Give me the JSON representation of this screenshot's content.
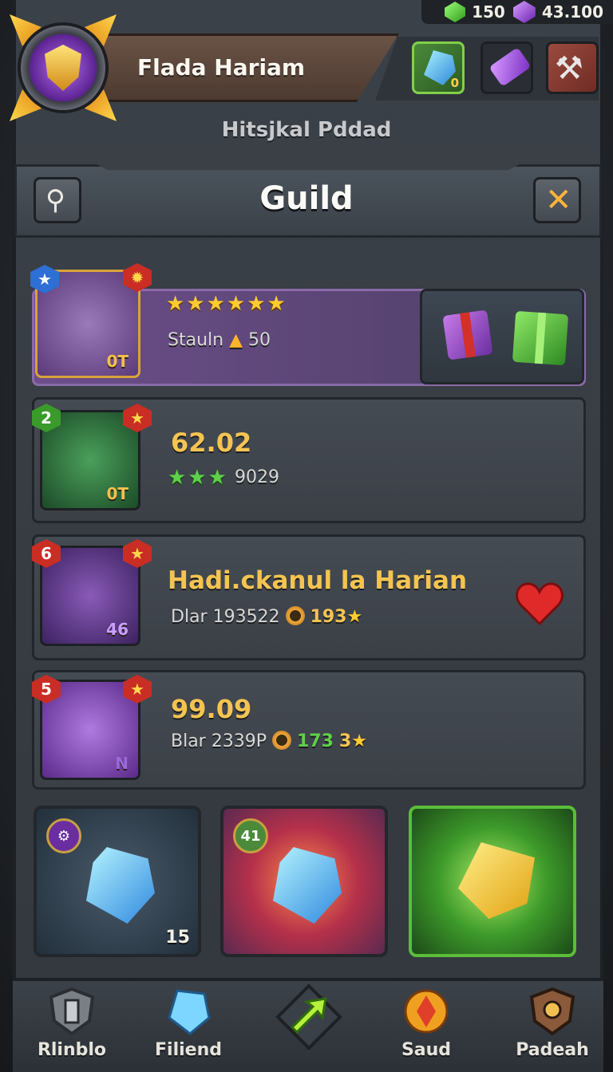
{
  "currency": {
    "green_gems": "150",
    "purple_gems": "43.100"
  },
  "header": {
    "title": "Flada Hariam",
    "subtitle": "Ηitsjkal Pddad",
    "crystal_badge": "0"
  },
  "guild_bar": {
    "title": "Guild"
  },
  "rows": [
    {
      "stars": "★★★★★★",
      "subtitle": "Stauln",
      "subtitle_value": "50",
      "thumb_label": "0T"
    },
    {
      "badge": "2",
      "title": "62.02",
      "stars": "★★★",
      "subtitle": "9029",
      "thumb_label": "0T"
    },
    {
      "badge": "6",
      "title": "Hadi.ckanul la Harian",
      "subtitle": "Dlar 193522",
      "subtitle_value": "193",
      "thumb_label": "46"
    },
    {
      "badge": "5",
      "title": "99.09",
      "subtitle": "Blar 2339P",
      "subtitle_value": "3",
      "subtitle_extra": "173",
      "thumb_label": "N"
    }
  ],
  "tiles": [
    {
      "count": "15"
    },
    {
      "badge": "41"
    },
    {}
  ],
  "bottom_nav": [
    {
      "label": "Rlinblo"
    },
    {
      "label": "Filiend"
    },
    {
      "label": ""
    },
    {
      "label": "Saud"
    },
    {
      "label": "Padeah"
    }
  ],
  "colors": {
    "accent_gold": "#f4c451",
    "featured_row": "#6c4e8a",
    "panel": "#3b4047"
  }
}
